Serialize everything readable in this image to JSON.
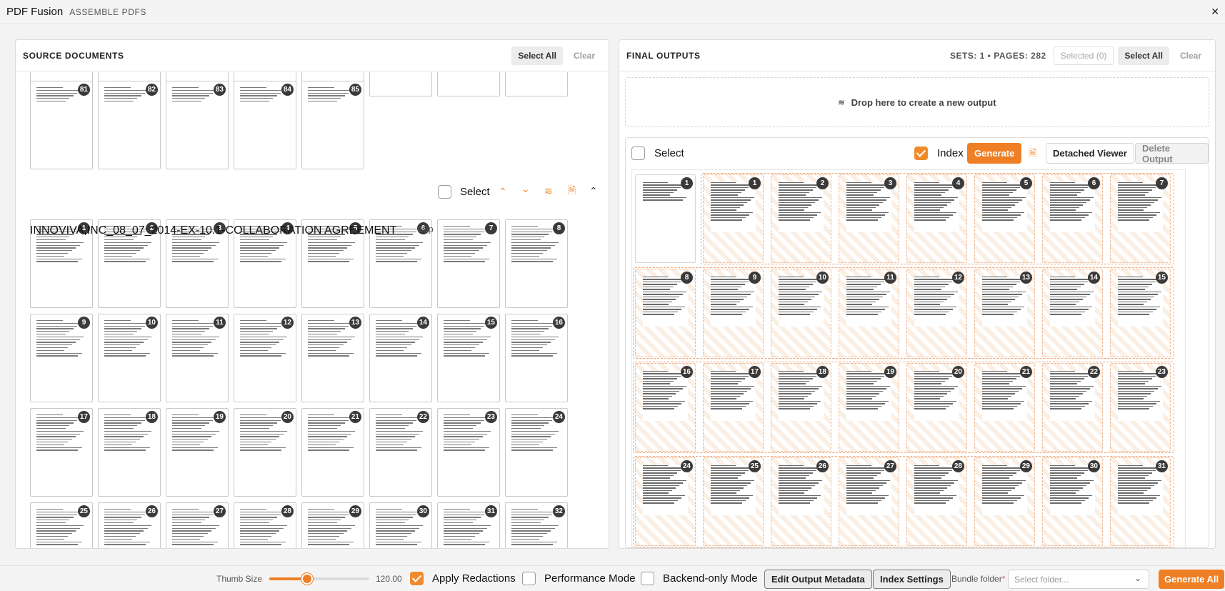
{
  "app": {
    "title": "PDF Fusion",
    "subtitle": "ASSEMBLE PDFS",
    "close_glyph": "✕"
  },
  "source": {
    "title": "SOURCE DOCUMENTS",
    "select_all": "Select All",
    "clear": "Clear",
    "prev_doc_pages": [
      "81",
      "82",
      "83",
      "84",
      "85"
    ],
    "document": {
      "name": "INNOVIVA,INC_08_07_2014-EX-10.1-COLLABORATION AGREEMENT",
      "page_count": "66p",
      "select_label": "Select",
      "icons": [
        "chevron-up-icon",
        "chevron-down-icon",
        "layers-icon",
        "file-icon",
        "collapse-icon"
      ],
      "pages": [
        "1",
        "2",
        "3",
        "4",
        "5",
        "6",
        "7",
        "8",
        "9",
        "10",
        "11",
        "12",
        "13",
        "14",
        "15",
        "16",
        "17",
        "18",
        "19",
        "20",
        "21",
        "22",
        "23",
        "24",
        "25",
        "26",
        "27",
        "28",
        "29",
        "30",
        "31",
        "32"
      ]
    }
  },
  "outputs": {
    "title": "FINAL OUTPUTS",
    "sets_info": "SETS: 1 • PAGES: 282",
    "selected": "Selected (0)",
    "select_all": "Select All",
    "clear": "Clear",
    "drop_text": "Drop here to create a new output",
    "card": {
      "select_label": "Select",
      "index_label": "Index",
      "index_checked": true,
      "generate": "Generate",
      "detached_viewer": "Detached Viewer",
      "delete_output": "Delete Output",
      "index_page": "1",
      "pages": [
        "1",
        "2",
        "3",
        "4",
        "5",
        "6",
        "7",
        "8",
        "9",
        "10",
        "11",
        "12",
        "13",
        "14",
        "15",
        "16",
        "17",
        "18",
        "19",
        "20",
        "21",
        "22",
        "23",
        "24",
        "25",
        "26",
        "27",
        "28",
        "29",
        "30",
        "31"
      ]
    }
  },
  "footer": {
    "thumb_size_label": "Thumb Size",
    "thumb_size_value": "120.00",
    "thumb_size_fraction": 0.38,
    "apply_redactions": "Apply Redactions",
    "apply_redactions_checked": true,
    "performance_mode": "Performance Mode",
    "backend_only_mode": "Backend-only Mode",
    "edit_output_metadata": "Edit Output Metadata",
    "index_settings": "Index Settings",
    "bundle_folder_label": "Bundle folder",
    "required_mark": "*",
    "select_folder_placeholder": "Select folder...",
    "generate_all": "Generate All"
  },
  "colors": {
    "accent": "#ef7f24",
    "hatch": "#fbeee3"
  }
}
